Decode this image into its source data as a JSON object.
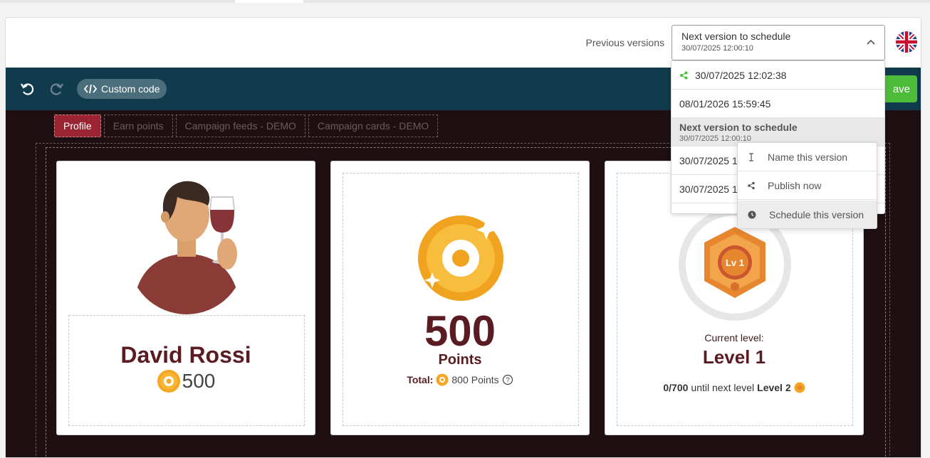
{
  "header": {
    "previous_versions_label": "Previous versions",
    "selected_version_title": "Next version to schedule",
    "selected_version_date": "30/07/2025 12:00:10",
    "language_flag": "uk-flag-icon"
  },
  "toolbar": {
    "custom_code_label": "Custom code",
    "save_label": "ave"
  },
  "tabs": [
    {
      "label": "Profile",
      "active": true
    },
    {
      "label": "Earn points",
      "active": false
    },
    {
      "label": "Campaign feeds - DEMO",
      "active": false
    },
    {
      "label": "Campaign cards - DEMO",
      "active": false
    }
  ],
  "profile_card": {
    "name": "David Rossi",
    "points": "500"
  },
  "points_card": {
    "value": "500",
    "unit": "Points",
    "total_label": "Total:",
    "total_value": "800",
    "total_unit": "Points"
  },
  "level_card": {
    "badge_text": "Lv 1",
    "current_level_label": "Current level:",
    "level_name": "Level 1",
    "progress_text": "0/700",
    "until_text": "until next level",
    "next_level": "Level 2",
    "progress_fraction": 0
  },
  "versions_dropdown": {
    "items": [
      {
        "date": "30/07/2025 12:02:38",
        "published": true
      },
      {
        "date": "08/01/2026 15:59:45",
        "published": false
      },
      {
        "title": "Next version to schedule",
        "date": "30/07/2025 12:00:10",
        "selected": true
      },
      {
        "date": "30/07/2025 1"
      },
      {
        "date": "30/07/2025 1"
      }
    ]
  },
  "context_menu": {
    "items": [
      {
        "label": "Name this version",
        "icon": "text-cursor-icon"
      },
      {
        "label": "Publish now",
        "icon": "share-icon"
      },
      {
        "label": "Schedule this version",
        "icon": "clock-icon"
      }
    ]
  },
  "colors": {
    "toolbar_bg": "#0f3b4d",
    "canvas_bg": "#1e1012",
    "accent_red": "#9a2431",
    "brand_text": "#5a1c22",
    "save_green": "#4cbc3a",
    "published_green": "#4cbc3a",
    "coin_orange": "#f5a623"
  }
}
